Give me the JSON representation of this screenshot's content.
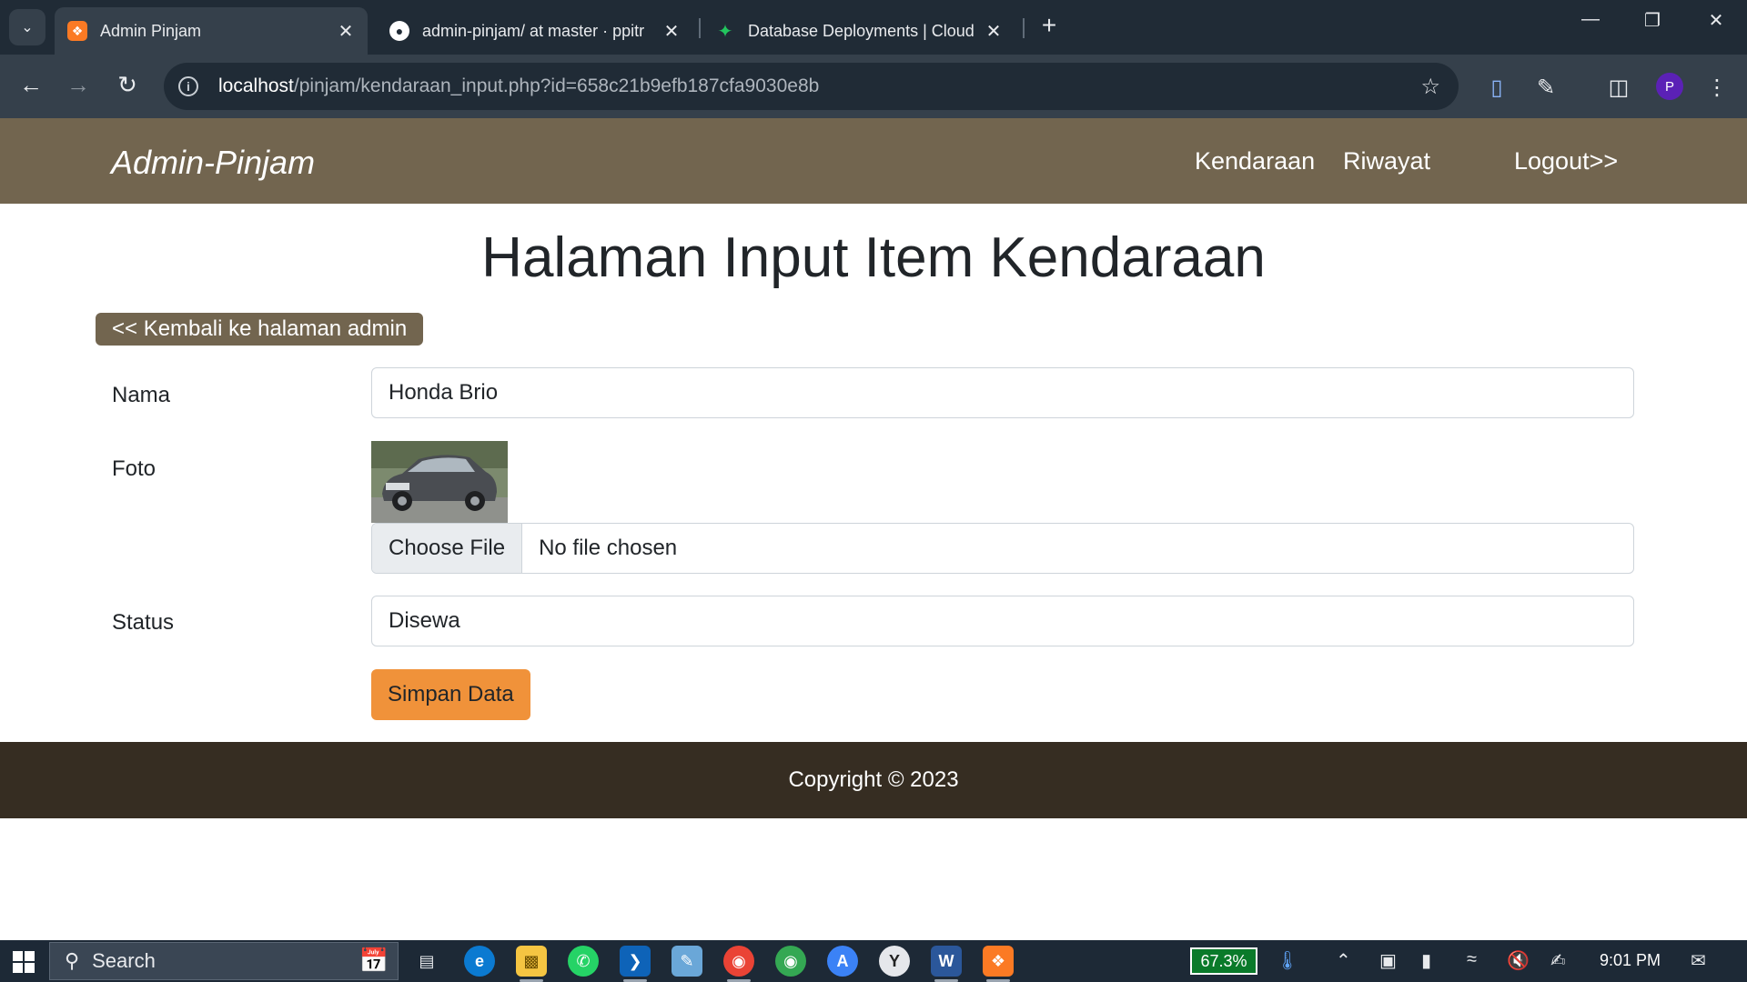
{
  "browser": {
    "tabs": [
      {
        "title": "Admin Pinjam",
        "icon": "xampp-icon",
        "active": true
      },
      {
        "title": "admin-pinjam/ at master · ppitr",
        "icon": "github-icon",
        "active": false
      },
      {
        "title": "Database Deployments | Cloud:",
        "icon": "mongodb-icon",
        "active": false
      }
    ],
    "new_tab_label": "+",
    "url_host": "localhost",
    "url_path": "/pinjam/kendaraan_input.php?id=658c21b9efb187cfa9030e8b",
    "profile_initial": "P"
  },
  "site": {
    "brand": "Admin-Pinjam",
    "nav": {
      "kendaraan": "Kendaraan",
      "riwayat": "Riwayat",
      "logout": "Logout>>"
    }
  },
  "main": {
    "title": "Halaman Input Item Kendaraan",
    "back_button": "<< Kembali ke halaman admin",
    "form": {
      "nama_label": "Nama",
      "nama_value": "Honda Brio",
      "foto_label": "Foto",
      "file_button": "Choose File",
      "file_status": "No file chosen",
      "status_label": "Status",
      "status_value": "Disewa",
      "submit": "Simpan Data"
    }
  },
  "footer": {
    "copyright": "Copyright © 2023"
  },
  "taskbar": {
    "search_label": "Search",
    "cpu_percent": "67.3%",
    "time": "9:01 PM"
  },
  "colors": {
    "navbar": "#72654f",
    "footer": "#362d22",
    "save_button": "#f0923a"
  }
}
